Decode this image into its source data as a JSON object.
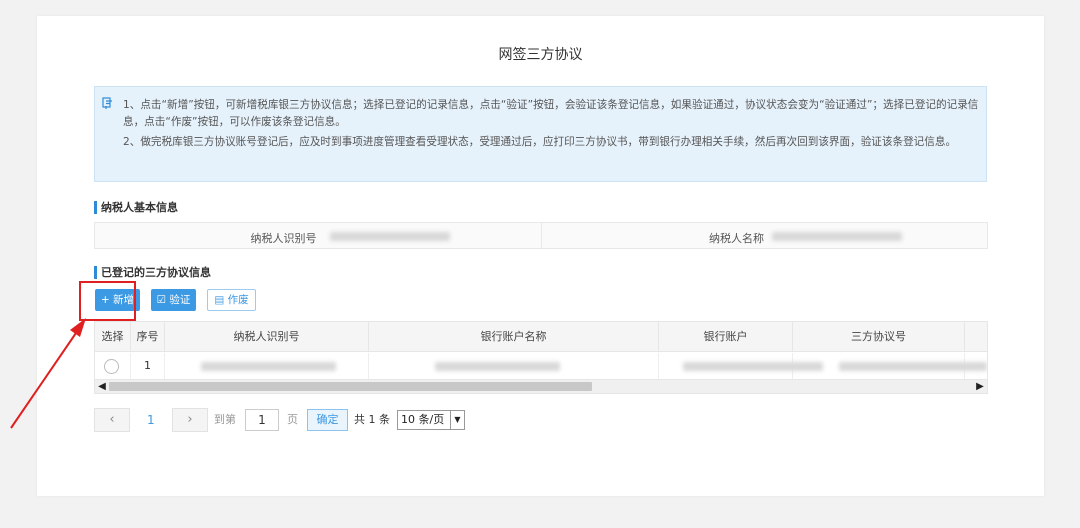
{
  "page": {
    "title": "网签三方协议"
  },
  "notice": {
    "line1": "1、点击“新增”按钮，可新增税库银三方协议信息；选择已登记的记录信息，点击“验证”按钮，会验证该条登记信息，如果验证通过，协议状态会变为“验证通过”；选择已登记的记录信息，点击“作废”按钮，可以作废该条登记信息。",
    "line2": "2、做完税库银三方协议账号登记后，应及时到事项进度管理查看受理状态，受理通过后，应打印三方协议书，带到银行办理相关手续，然后再次回到该界面，验证该条登记信息。"
  },
  "taxpayer_section": {
    "title": "纳税人基本信息",
    "id_label": "纳税人识别号",
    "name_label": "纳税人名称"
  },
  "agreement_section": {
    "title": "已登记的三方协议信息",
    "add_label": "+ 新增",
    "verify_label": "☑ 验证",
    "void_label": "▤ 作废"
  },
  "table": {
    "columns": [
      "选择",
      "序号",
      "纳税人识别号",
      "银行账户名称",
      "银行账户",
      "三方协议号"
    ],
    "rows": [
      {
        "seq": "1"
      }
    ]
  },
  "pagination": {
    "prev": "‹",
    "current": "1",
    "next": "›",
    "goto_label": "到第",
    "page_input": "1",
    "page_unit": "页",
    "confirm_label": "确定",
    "total": "共 1 条",
    "page_size": "10 条/页"
  },
  "colors": {
    "accent": "#3c99e3",
    "highlight": "#e02020",
    "notice_bg": "#e6f2fb"
  }
}
